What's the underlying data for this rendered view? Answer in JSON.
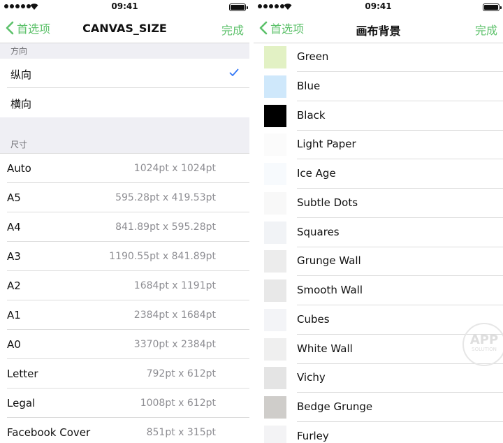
{
  "status_bar": {
    "time": "09:41"
  },
  "colors": {
    "accent": "#5cc16a",
    "check": "#3478f6"
  },
  "left": {
    "nav": {
      "back_label": "首选项",
      "title": "CANVAS_SIZE",
      "done_label": "完成"
    },
    "orientation": {
      "header": "方向",
      "options": [
        {
          "label": "纵向",
          "selected": true
        },
        {
          "label": "横向",
          "selected": false
        }
      ]
    },
    "size": {
      "header": "尺寸",
      "items": [
        {
          "name": "Auto",
          "value": "1024pt x 1024pt"
        },
        {
          "name": "A5",
          "value": "595.28pt x 419.53pt"
        },
        {
          "name": "A4",
          "value": "841.89pt x 595.28pt"
        },
        {
          "name": "A3",
          "value": "1190.55pt x 841.89pt"
        },
        {
          "name": "A2",
          "value": "1684pt x 1191pt"
        },
        {
          "name": "A1",
          "value": "2384pt x 1684pt"
        },
        {
          "name": "A0",
          "value": "3370pt x 2384pt"
        },
        {
          "name": "Letter",
          "value": "792pt x 612pt"
        },
        {
          "name": "Legal",
          "value": "1008pt x 612pt"
        },
        {
          "name": "Facebook Cover",
          "value": "851pt x 315pt"
        }
      ]
    }
  },
  "right": {
    "nav": {
      "back_label": "首选项",
      "title": "画布背景",
      "done_label": "完成"
    },
    "backgrounds": [
      {
        "name": "Green",
        "swatch_color": "#e2f1c4"
      },
      {
        "name": "Blue",
        "swatch_color": "#cfe8fb"
      },
      {
        "name": "Black",
        "swatch_color": "#000000"
      },
      {
        "name": "Light Paper",
        "swatch_color": "#fbfbfb"
      },
      {
        "name": "Ice Age",
        "swatch_color": "#f7fafd"
      },
      {
        "name": "Subtle Dots",
        "swatch_color": "#f8f8f8"
      },
      {
        "name": "Squares",
        "swatch_color": "#f1f3f6"
      },
      {
        "name": "Grunge Wall",
        "swatch_color": "#ececec"
      },
      {
        "name": "Smooth Wall",
        "swatch_color": "#e8e8e8"
      },
      {
        "name": "Cubes",
        "swatch_color": "#f3f4f7"
      },
      {
        "name": "White Wall",
        "swatch_color": "#efefef"
      },
      {
        "name": "Vichy",
        "swatch_color": "#e4e4e4"
      },
      {
        "name": "Bedge Grunge",
        "swatch_color": "#cfcdca"
      },
      {
        "name": "Furley",
        "swatch_color": "#f3f3f5"
      }
    ]
  },
  "watermark": {
    "main": "APP",
    "sub": "SOLUTION"
  }
}
